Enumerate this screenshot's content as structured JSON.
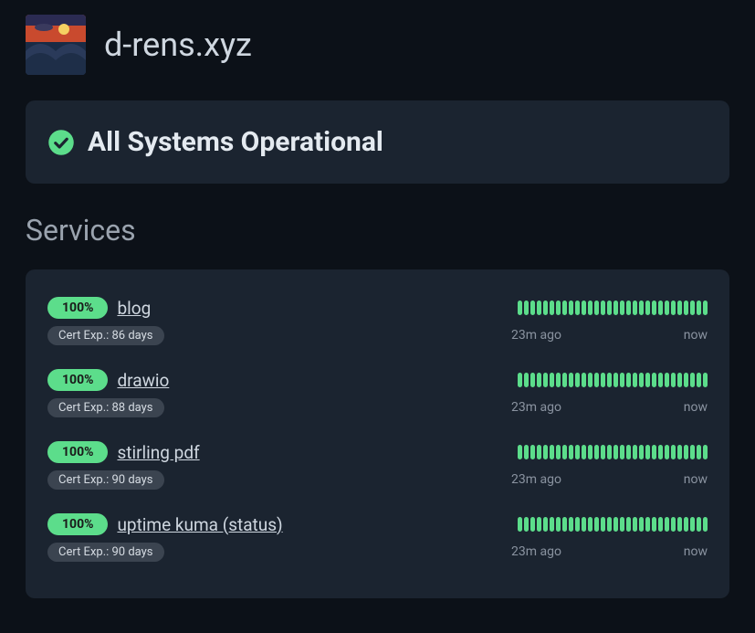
{
  "site_title": "d-rens.xyz",
  "status_banner": "All Systems Operational",
  "services_heading": "Services",
  "colors": {
    "accent_green": "#5cdd8b",
    "bg": "#0c1118",
    "panel": "#1b2430"
  },
  "services": [
    {
      "uptime": "100%",
      "name": "blog",
      "cert": "Cert Exp.: 86 days",
      "time_from": "23m ago",
      "time_to": "now"
    },
    {
      "uptime": "100%",
      "name": "drawio",
      "cert": "Cert Exp.: 88 days",
      "time_from": "23m ago",
      "time_to": "now"
    },
    {
      "uptime": "100%",
      "name": "stirling pdf",
      "cert": "Cert Exp.: 90 days",
      "time_from": "23m ago",
      "time_to": "now"
    },
    {
      "uptime": "100%",
      "name": "uptime kuma (status)",
      "cert": "Cert Exp.: 90 days",
      "time_from": "23m ago",
      "time_to": "now"
    }
  ]
}
